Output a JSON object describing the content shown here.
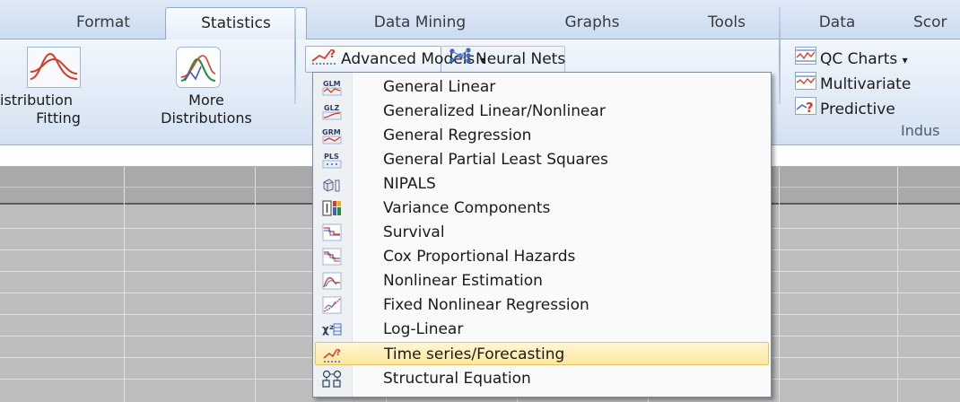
{
  "tabs": [
    {
      "label": "Format",
      "active": false
    },
    {
      "label": "Statistics",
      "active": true
    },
    {
      "label": "Data Mining",
      "active": false
    },
    {
      "label": "Graphs",
      "active": false
    },
    {
      "label": "Tools",
      "active": false
    },
    {
      "label": "Data",
      "active": false
    },
    {
      "label": "Scor",
      "active": false
    }
  ],
  "ribbon": {
    "distribution_fitting": {
      "line1": "istribution",
      "line2": "Fitting"
    },
    "more_distributions": {
      "line1": "More",
      "line2": "Distributions"
    },
    "advanced_models": "Advanced Models",
    "neural_nets": "Neural Nets",
    "qc_charts": "QC Charts",
    "multivariate": "Multivariate",
    "predictive": "Predictive",
    "industrial_group_label": "Indus"
  },
  "menu": {
    "items": [
      {
        "label": "General Linear",
        "icon": "glm-icon"
      },
      {
        "label": "Generalized Linear/Nonlinear",
        "icon": "glz-icon"
      },
      {
        "label": "General Regression",
        "icon": "grm-icon"
      },
      {
        "label": "General Partial Least Squares",
        "icon": "pls-icon"
      },
      {
        "label": "NIPALS",
        "icon": "nipals-icon"
      },
      {
        "label": "Variance Components",
        "icon": "variance-icon"
      },
      {
        "label": "Survival",
        "icon": "survival-icon"
      },
      {
        "label": "Cox Proportional Hazards",
        "icon": "cox-icon"
      },
      {
        "label": "Nonlinear Estimation",
        "icon": "nonlinear-icon"
      },
      {
        "label": "Fixed Nonlinear Regression",
        "icon": "fixed-nonlinear-icon"
      },
      {
        "label": "Log-Linear",
        "icon": "loglinear-icon"
      },
      {
        "label": "Time series/Forecasting",
        "icon": "timeseries-icon",
        "selected": true
      },
      {
        "label": "Structural Equation",
        "icon": "sem-icon"
      }
    ]
  },
  "colors": {
    "ribbon": "#dde8f5",
    "selected_item": "#ffe7a1",
    "grid": "#bdbdbd"
  }
}
